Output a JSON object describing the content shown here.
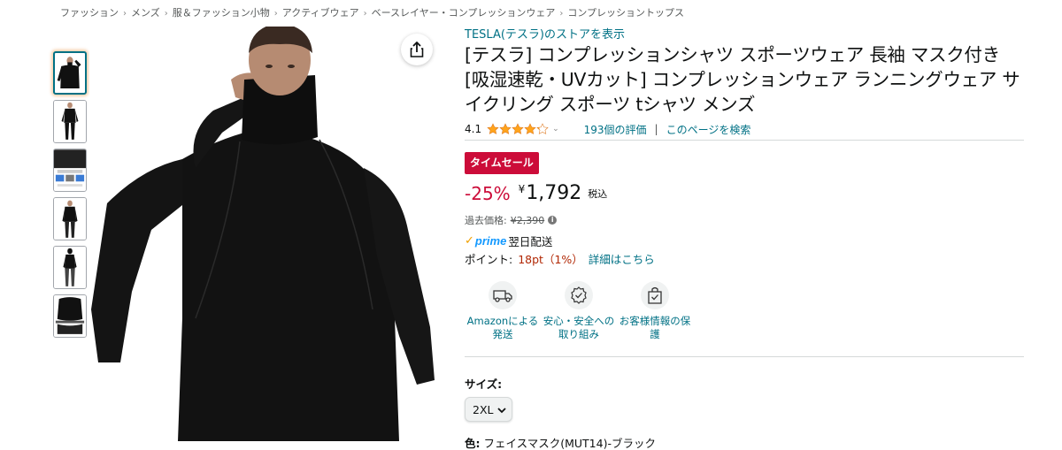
{
  "breadcrumb": [
    "ファッション",
    "メンズ",
    "服＆ファッション小物",
    "アクティブウェア",
    "ベースレイヤー・コンプレッションウェア",
    "コンプレッショントップス"
  ],
  "breadcrumb_separator": "›",
  "product": {
    "store_link": "TESLA(テスラ)のストアを表示",
    "title": "[テスラ] コンプレッションシャツ スポーツウェア 長袖 マスク付き [吸湿速乾・UVカット] コンプレッションウェア ランニングウェア サイクリング スポーツ tシャツ メンズ",
    "rating": "4.1",
    "rating_stars": 4.1,
    "review_count": "193個の評価",
    "search_page": "このページを検索"
  },
  "pricing": {
    "badge": "タイムセール",
    "discount": "-25%",
    "currency": "¥",
    "price": "1,792",
    "tax_note": "税込",
    "list_price_label": "過去価格:",
    "list_price": "¥2,390",
    "prime_check": "✓",
    "prime_word": "prime",
    "delivery": "翌日配送",
    "points_label": "ポイント:",
    "points_value": "18pt（1%）",
    "points_link": "詳細はこちら"
  },
  "features": [
    {
      "label": "Amazonによる発送",
      "icon": "truck-icon"
    },
    {
      "label": "安心・安全への取り組み",
      "icon": "shield-badge-icon"
    },
    {
      "label": "お客様情報の保護",
      "icon": "secure-bag-icon"
    }
  ],
  "options": {
    "size_label": "サイズ:",
    "size_selected": "2XL",
    "color_label": "色:",
    "color_value": "フェイスマスク(MUT14)-ブラック"
  },
  "colors": {
    "link": "#007185",
    "deal_red": "#cc0c39",
    "points_red": "#b12704",
    "star": "#ffa41c",
    "prime_blue": "#1399ff"
  }
}
